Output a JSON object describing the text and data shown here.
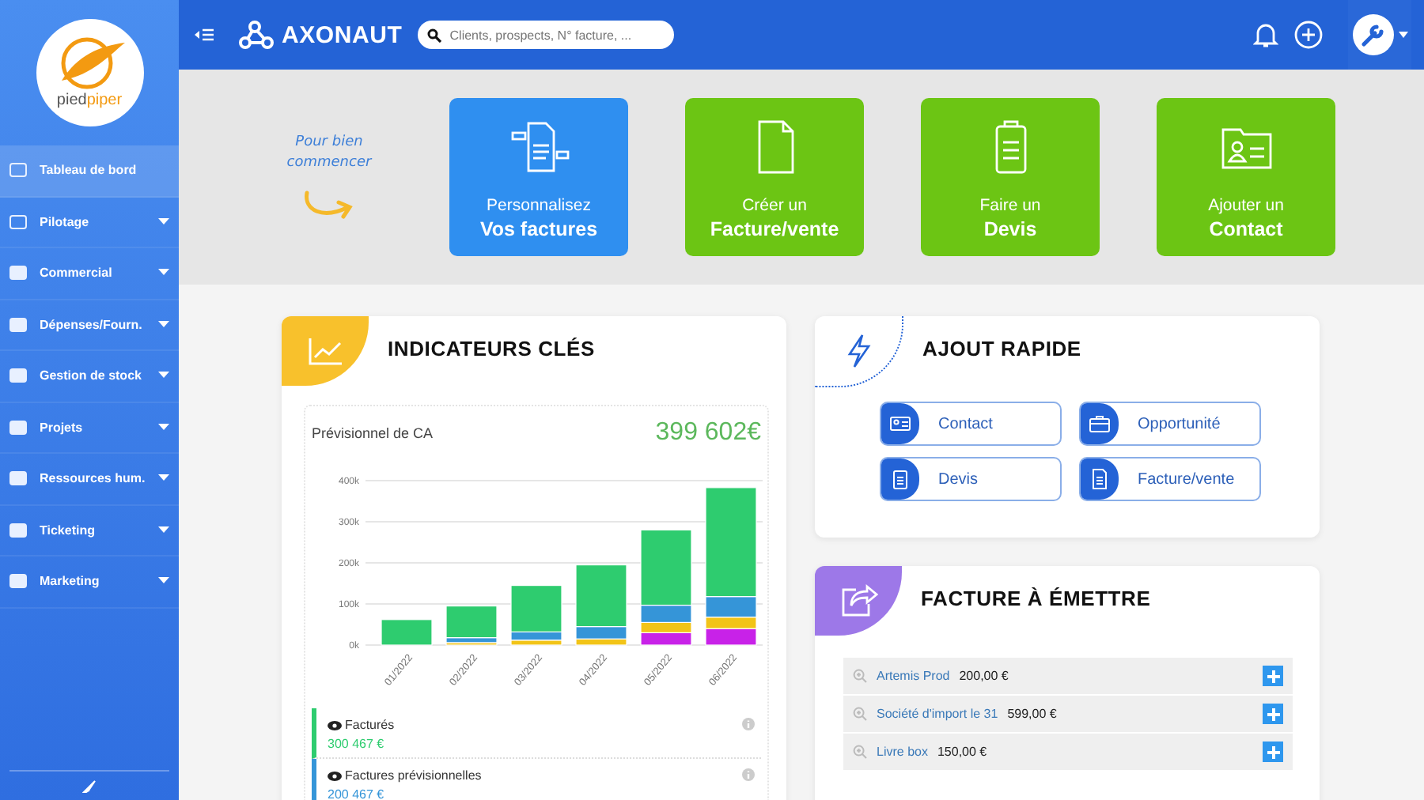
{
  "logo": {
    "part1": "pied",
    "part2": "piper"
  },
  "sidebar": {
    "items": [
      {
        "label": "Tableau de bord",
        "selected": true,
        "expandable": false
      },
      {
        "label": "Pilotage",
        "selected": false,
        "expandable": true
      },
      {
        "label": "Commercial",
        "selected": false,
        "expandable": true
      },
      {
        "label": "Dépenses/Fourn.",
        "selected": false,
        "expandable": true
      },
      {
        "label": "Gestion de stock",
        "selected": false,
        "expandable": true
      },
      {
        "label": "Projets",
        "selected": false,
        "expandable": true
      },
      {
        "label": "Ressources hum.",
        "selected": false,
        "expandable": true
      },
      {
        "label": "Ticketing",
        "selected": false,
        "expandable": true
      },
      {
        "label": "Marketing",
        "selected": false,
        "expandable": true
      }
    ]
  },
  "header": {
    "brand": "AXONAUT",
    "search": {
      "placeholder": "Clients, prospects, N° facture, ..."
    }
  },
  "banner": {
    "intro_line1": "Pour bien",
    "intro_line2": "commencer",
    "tiles": [
      {
        "line1": "Personnalisez",
        "line2": "Vos factures",
        "color": "#2f8ff0"
      },
      {
        "line1": "Créer un",
        "line2": "Facture/vente",
        "color": "#6cc514"
      },
      {
        "line1": "Faire un",
        "line2": "Devis",
        "color": "#6cc514"
      },
      {
        "line1": "Ajouter un",
        "line2": "Contact",
        "color": "#6cc514"
      }
    ]
  },
  "indicators": {
    "title": "INDICATEURS CLÉS",
    "subtitle": "Prévisionnel de CA",
    "total": "399 602€",
    "chart_data": {
      "type": "bar",
      "stacked": true,
      "categories": [
        "01/2022",
        "02/2022",
        "03/2022",
        "04/2022",
        "05/2022",
        "06/2022"
      ],
      "ylim": [
        0,
        400000
      ],
      "grid": true,
      "yticks": [
        {
          "value": 0,
          "label": "0k"
        },
        {
          "value": 100000,
          "label": "100k"
        },
        {
          "value": 200000,
          "label": "200k"
        },
        {
          "value": 300000,
          "label": "300k"
        },
        {
          "value": 400000,
          "label": "400k"
        }
      ],
      "series": [
        {
          "color": "#c822e8",
          "values": [
            0,
            0,
            0,
            0,
            30000,
            40000
          ]
        },
        {
          "color": "#f2c418",
          "values": [
            0,
            6000,
            12000,
            15000,
            25000,
            28000
          ]
        },
        {
          "color": "#3595d8",
          "values": [
            0,
            12000,
            20000,
            30000,
            42000,
            50000
          ]
        },
        {
          "color": "#2ecc6f",
          "values": [
            62000,
            77000,
            113000,
            150000,
            183000,
            265000
          ]
        }
      ]
    },
    "legend": [
      {
        "label": "Facturés",
        "amount": "300 467 €",
        "color": "#2ecc6f"
      },
      {
        "label": "Factures prévisionnelles",
        "amount": "200 467 €",
        "color": "#3595d8"
      }
    ]
  },
  "quick_add": {
    "title": "AJOUT RAPIDE",
    "buttons": [
      "Contact",
      "Opportunité",
      "Devis",
      "Facture/vente"
    ]
  },
  "to_issue": {
    "title": "FACTURE À ÉMETTRE",
    "rows": [
      {
        "client": "Artemis Prod",
        "amount": "200,00 €"
      },
      {
        "client": "Société d'import le 31",
        "amount": "599,00 €"
      },
      {
        "client": "Livre box",
        "amount": "150,00 €"
      }
    ]
  }
}
